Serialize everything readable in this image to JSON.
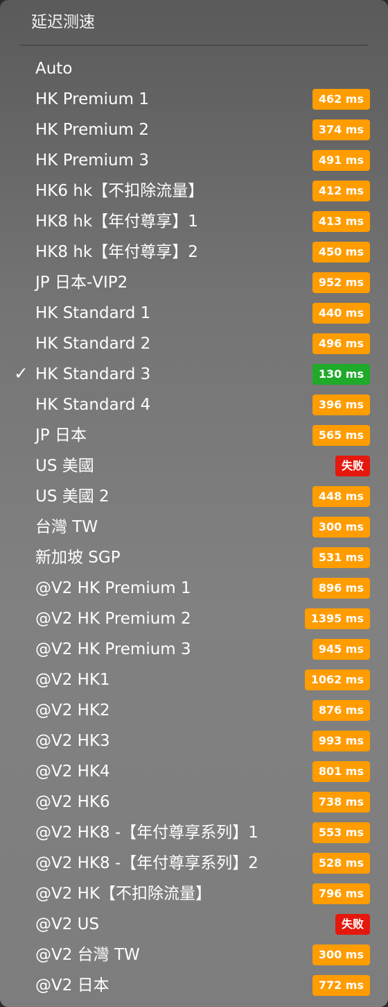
{
  "menu": {
    "title": "延迟测速",
    "colors": {
      "ok": "#ff9c00",
      "fast": "#1faa2a",
      "fail": "#e5180d"
    },
    "items": [
      {
        "label": "Auto",
        "latency": null,
        "status": "none",
        "selected": false
      },
      {
        "label": "HK Premium 1",
        "latency": "462 ms",
        "status": "ok",
        "selected": false
      },
      {
        "label": "HK Premium 2",
        "latency": "374 ms",
        "status": "ok",
        "selected": false
      },
      {
        "label": "HK Premium 3",
        "latency": "491 ms",
        "status": "ok",
        "selected": false
      },
      {
        "label": "HK6 hk【不扣除流量】",
        "latency": "412 ms",
        "status": "ok",
        "selected": false
      },
      {
        "label": "HK8 hk【年付尊享】1",
        "latency": "413 ms",
        "status": "ok",
        "selected": false
      },
      {
        "label": "HK8 hk【年付尊享】2",
        "latency": "450 ms",
        "status": "ok",
        "selected": false
      },
      {
        "label": "JP 日本-VIP2",
        "latency": "952 ms",
        "status": "ok",
        "selected": false
      },
      {
        "label": "HK Standard 1",
        "latency": "440 ms",
        "status": "ok",
        "selected": false
      },
      {
        "label": "HK Standard 2",
        "latency": "496 ms",
        "status": "ok",
        "selected": false
      },
      {
        "label": "HK Standard 3",
        "latency": "130 ms",
        "status": "fast",
        "selected": true
      },
      {
        "label": "HK Standard 4",
        "latency": "396 ms",
        "status": "ok",
        "selected": false
      },
      {
        "label": "JP 日本",
        "latency": "565 ms",
        "status": "ok",
        "selected": false
      },
      {
        "label": "US 美國",
        "latency": "失败",
        "status": "fail",
        "selected": false
      },
      {
        "label": "US 美國 2",
        "latency": "448 ms",
        "status": "ok",
        "selected": false
      },
      {
        "label": "台灣 TW",
        "latency": "300 ms",
        "status": "ok",
        "selected": false
      },
      {
        "label": "新加坡 SGP",
        "latency": "531 ms",
        "status": "ok",
        "selected": false
      },
      {
        "label": "@V2 HK Premium 1",
        "latency": "896 ms",
        "status": "ok",
        "selected": false
      },
      {
        "label": "@V2 HK Premium 2",
        "latency": "1395 ms",
        "status": "ok",
        "selected": false
      },
      {
        "label": "@V2 HK Premium 3",
        "latency": "945 ms",
        "status": "ok",
        "selected": false
      },
      {
        "label": "@V2 HK1",
        "latency": "1062 ms",
        "status": "ok",
        "selected": false
      },
      {
        "label": "@V2 HK2",
        "latency": "876 ms",
        "status": "ok",
        "selected": false
      },
      {
        "label": "@V2 HK3",
        "latency": "993 ms",
        "status": "ok",
        "selected": false
      },
      {
        "label": "@V2 HK4",
        "latency": "801 ms",
        "status": "ok",
        "selected": false
      },
      {
        "label": "@V2 HK6",
        "latency": "738 ms",
        "status": "ok",
        "selected": false
      },
      {
        "label": "@V2 HK8 -【年付尊享系列】1",
        "latency": "553 ms",
        "status": "ok",
        "selected": false
      },
      {
        "label": "@V2 HK8 -【年付尊享系列】2",
        "latency": "528 ms",
        "status": "ok",
        "selected": false
      },
      {
        "label": "@V2 HK【不扣除流量】",
        "latency": "796 ms",
        "status": "ok",
        "selected": false
      },
      {
        "label": "@V2 US",
        "latency": "失败",
        "status": "fail",
        "selected": false
      },
      {
        "label": "@V2 台灣 TW",
        "latency": "300 ms",
        "status": "ok",
        "selected": false
      },
      {
        "label": "@V2 日本",
        "latency": "772 ms",
        "status": "ok",
        "selected": false
      }
    ]
  }
}
